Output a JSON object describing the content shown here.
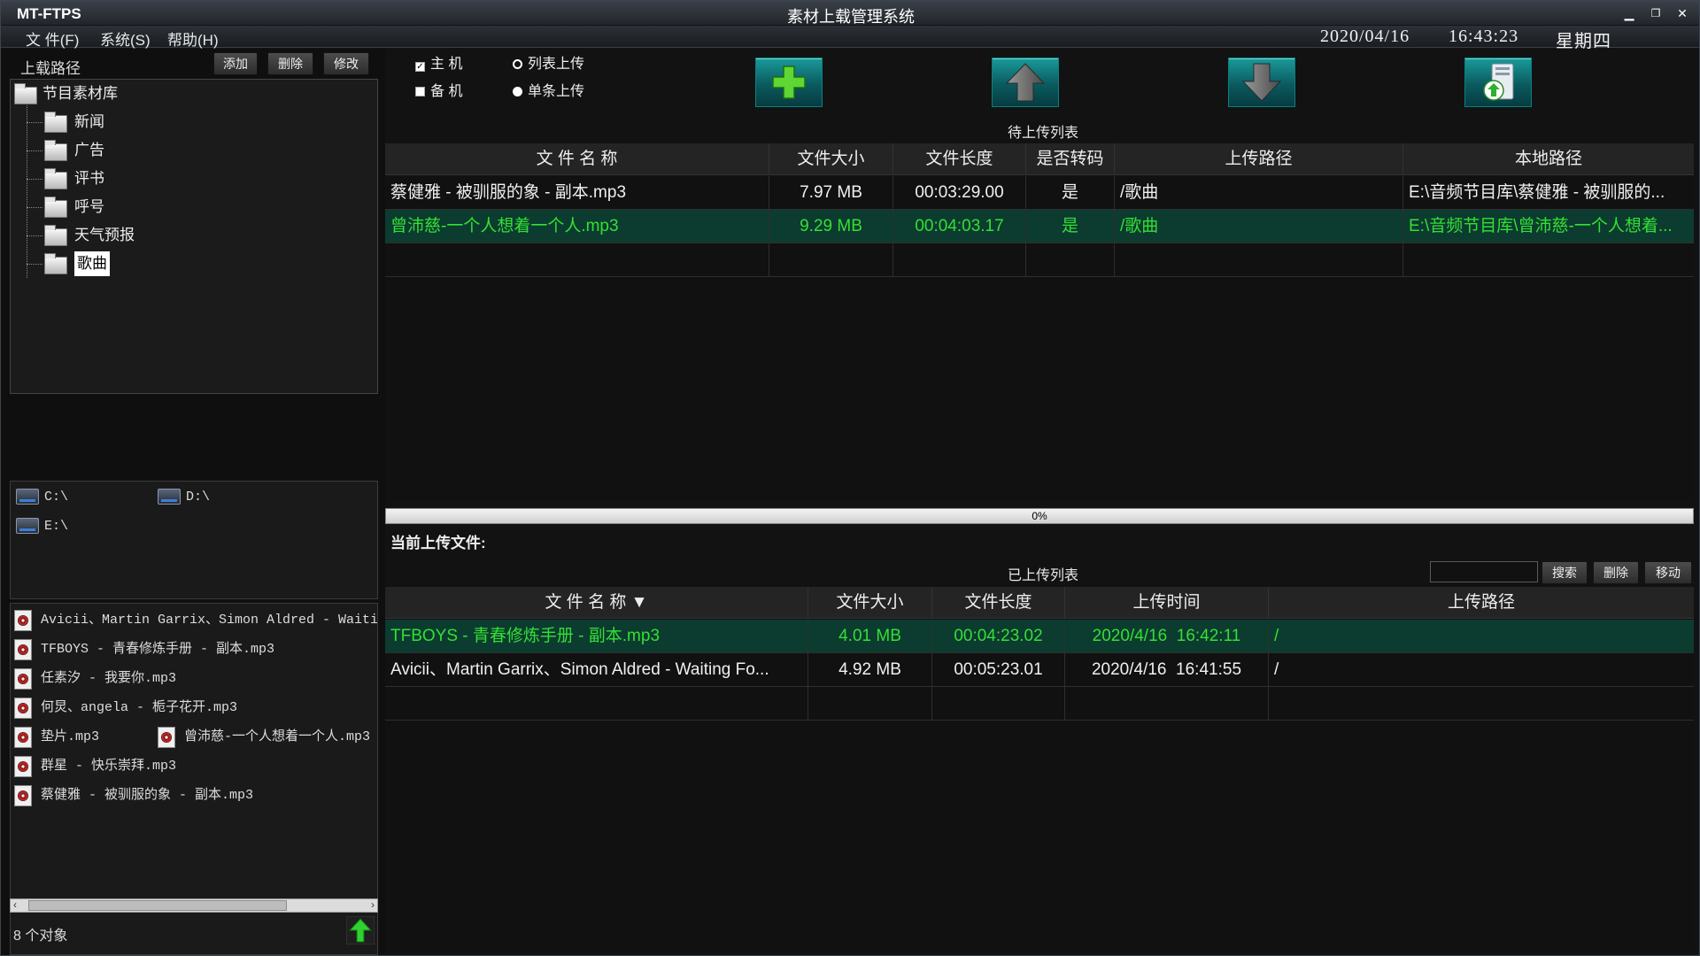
{
  "title_bar": {
    "app_name": "MT-FTPS",
    "window_title": "素材上载管理系统",
    "min": "▁",
    "restore": "❐",
    "close": "✕"
  },
  "menu": {
    "items": [
      "文 件(F)",
      "系统(S)",
      "帮助(H)"
    ],
    "date": "2020/04/16",
    "time": "16:43:23",
    "weekday": "星期四"
  },
  "upload_path": {
    "label": "上载路径",
    "buttons": {
      "add": "添加",
      "delete": "删除",
      "modify": "修改"
    },
    "root": "节目素材库",
    "children": [
      "新闻",
      "广告",
      "评书",
      "呼号",
      "天气预报",
      "歌曲"
    ],
    "selected": "歌曲"
  },
  "drives": [
    "C:\\",
    "D:\\",
    "E:\\"
  ],
  "local_files": [
    "Avicii、Martin Garrix、Simon Aldred - Waiting Fo",
    "TFBOYS - 青春修炼手册 - 副本.mp3",
    "任素汐 - 我要你.mp3",
    "何炅、angela - 栀子花开.mp3",
    "垫片.mp3",
    "曾沛慈-一个人想着一个人.mp3",
    "群星 - 快乐崇拜.mp3",
    "蔡健雅 - 被驯服的象 - 副本.mp3"
  ],
  "status_text": "8 个对象",
  "options": {
    "host": "主 机",
    "backup": "备 机",
    "list_upload": "列表上传",
    "single_upload": "单条上传",
    "host_checked": true,
    "backup_checked": false,
    "mode": "single"
  },
  "pending": {
    "title": "待上传列表",
    "columns": [
      "文 件 名 称",
      "文件大小",
      "文件长度",
      "是否转码",
      "上传路径",
      "本地路径"
    ],
    "rows": [
      {
        "name": "蔡健雅 - 被驯服的象 - 副本.mp3",
        "size": "7.97 MB",
        "length": "00:03:29.00",
        "transcode": "是",
        "upload_path": "/歌曲",
        "local_path": "E:\\音频节目库\\蔡健雅 - 被驯服的..."
      },
      {
        "name": "曾沛慈-一个人想着一个人.mp3",
        "size": "9.29 MB",
        "length": "00:04:03.17",
        "transcode": "是",
        "upload_path": "/歌曲",
        "local_path": "E:\\音频节目库\\曾沛慈-一个人想着..."
      }
    ],
    "selected_row": 1
  },
  "progress": {
    "label": "0%",
    "value": 0
  },
  "current_upload_label": "当前上传文件:",
  "uploaded": {
    "title": "已上传列表",
    "search_btn": "搜索",
    "delete_btn": "删除",
    "move_btn": "移动",
    "columns": [
      "文 件 名 称 ▼",
      "文件大小",
      "文件长度",
      "上传时间",
      "上传路径"
    ],
    "rows": [
      {
        "name": "TFBOYS - 青春修炼手册 - 副本.mp3",
        "size": "4.01 MB",
        "length": "00:04:23.02",
        "time": "2020/4/16  16:42:11",
        "path": "/"
      },
      {
        "name": "Avicii、Martin Garrix、Simon Aldred - Waiting Fo...",
        "size": "4.92 MB",
        "length": "00:05:23.01",
        "time": "2020/4/16  16:41:55",
        "path": "/"
      }
    ],
    "selected_row": 0
  },
  "colors": {
    "accent_green": "#33e033",
    "selected_row_bg": "#0c3b30",
    "toolbar_teal": "#0a5a5f"
  },
  "icons": {
    "add": "plus-icon",
    "up": "arrow-up-icon",
    "down": "arrow-down-icon",
    "upload": "server-upload-icon"
  }
}
